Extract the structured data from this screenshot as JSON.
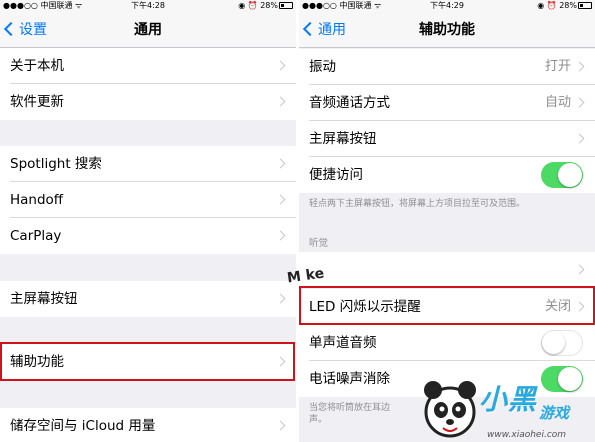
{
  "status_left": {
    "carrier": "中国联通",
    "time": "下午4:28",
    "battery": "28%"
  },
  "status_right": {
    "carrier": "中国联通",
    "time": "下午4:29",
    "battery": "28%"
  },
  "left": {
    "back_label": "设置",
    "title": "通用",
    "rows": [
      {
        "label": "关于本机"
      },
      {
        "label": "软件更新"
      },
      {
        "label": "Spotlight 搜索"
      },
      {
        "label": "Handoff"
      },
      {
        "label": "CarPlay"
      },
      {
        "label": "主屏幕按钮"
      },
      {
        "label": "辅助功能"
      },
      {
        "label": "储存空间与 iCloud 用量"
      }
    ]
  },
  "right": {
    "back_label": "通用",
    "title": "辅助功能",
    "rows": [
      {
        "label": "振动",
        "detail": "打开"
      },
      {
        "label": "音频通话方式",
        "detail": "自动"
      },
      {
        "label": "主屏幕按钮",
        "detail": ""
      },
      {
        "label": "便捷访问",
        "toggle": "on"
      },
      {
        "label": "",
        "detail": ""
      },
      {
        "label": "LED 闪烁以示提醒",
        "detail": "关闭"
      },
      {
        "label": "单声道音频",
        "toggle": "off"
      },
      {
        "label": "电话噪声消除",
        "toggle": "on"
      }
    ],
    "footnote_reach": "轻点两下主屏幕按钮，将屏幕上方项目拉至可及范围。",
    "section_hearing": "听觉",
    "footnote_noise": "当您将听筒放在耳边",
    "footnote_noise_2": "声。"
  },
  "colors": {
    "accent": "#007aff",
    "toggle_on": "#4cd964",
    "highlight": "#d0121b",
    "logo": "#2aa9e0"
  },
  "watermark": {
    "logo_main": "小黑",
    "logo_sub": "游戏",
    "url": "www.xiaohei.com"
  }
}
